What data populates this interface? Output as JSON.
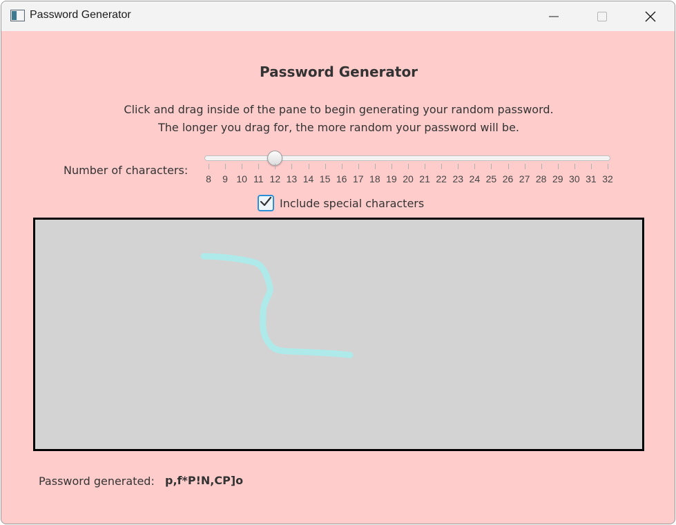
{
  "window": {
    "title": "Password Generator",
    "icons": {
      "app": "app-window-icon",
      "minimize": "minimize-icon",
      "maximize": "maximize-icon",
      "close": "close-icon"
    }
  },
  "main": {
    "heading": "Password Generator",
    "description_line1": "Click and drag inside of the pane to begin generating your random password.",
    "description_line2": "The longer you drag for, the more random your password will be."
  },
  "slider": {
    "label": "Number of characters:",
    "min": 8,
    "max": 32,
    "value": 12,
    "tick_labels": [
      "8",
      "9",
      "10",
      "11",
      "12",
      "13",
      "14",
      "15",
      "16",
      "17",
      "18",
      "19",
      "20",
      "21",
      "22",
      "23",
      "24",
      "25",
      "26",
      "27",
      "28",
      "29",
      "30",
      "31",
      "32"
    ]
  },
  "special_characters": {
    "label": "Include special characters",
    "checked": true
  },
  "draw_pane": {
    "background_color": "#d3d3d3",
    "stroke_color": "#aeeaea"
  },
  "result": {
    "label": "Password generated:",
    "value": "p,f*P!N,CP]o"
  },
  "colors": {
    "background": "#ffcccc",
    "accent": "#2b8fd6"
  }
}
